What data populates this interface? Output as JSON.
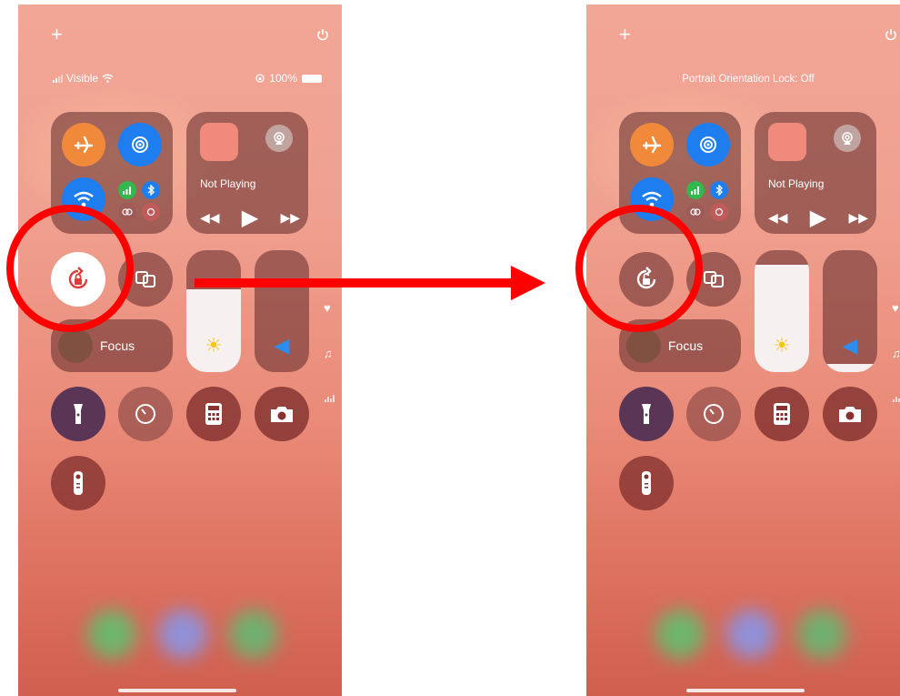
{
  "left_phone": {
    "plus_icon": "+",
    "carrier": "Visible",
    "battery": "100%",
    "media_status": "Not Playing",
    "focus_label": "Focus",
    "orientation_lock": "on"
  },
  "right_phone": {
    "plus_icon": "+",
    "status_message": "Portrait Orientation Lock: Off",
    "media_status": "Not Playing",
    "focus_label": "Focus",
    "orientation_lock": "off"
  },
  "icons": {
    "rewind": "◀◀",
    "play": "▶",
    "forward": "▶▶",
    "sun": "☀",
    "speaker": "◀",
    "heart": "♥",
    "music": "♫"
  },
  "colors": {
    "annotation": "#ff0000",
    "airplane": "#f08a3a",
    "blue_toggle": "#1e7ef0",
    "cellular": "#32b84e"
  }
}
